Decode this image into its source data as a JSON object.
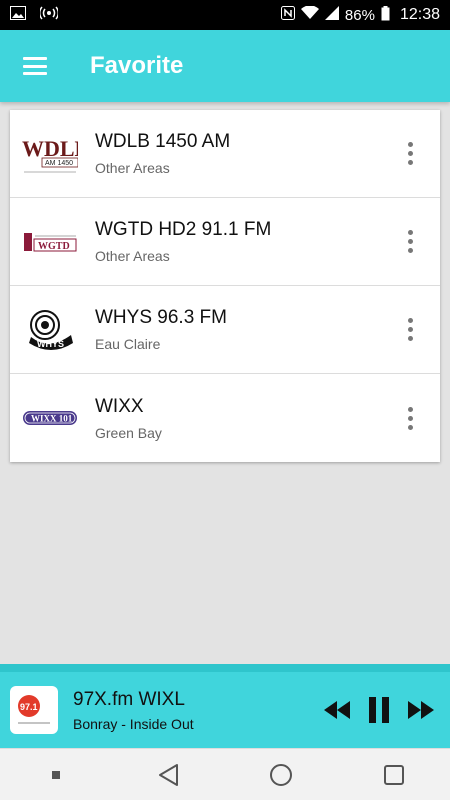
{
  "status_bar": {
    "battery": "86%",
    "time": "12:38",
    "icons": [
      "image-icon",
      "hotspot-icon",
      "nfc-icon",
      "wifi-icon",
      "signal-icon",
      "battery-icon"
    ]
  },
  "app_bar": {
    "title": "Favorite",
    "menu_icon": "hamburger-menu-icon"
  },
  "favorites": [
    {
      "name": "WDLB 1450 AM",
      "area": "Other Areas",
      "logo": "wdlb-logo"
    },
    {
      "name": "WGTD HD2 91.1 FM",
      "area": "Other Areas",
      "logo": "wgtd-logo"
    },
    {
      "name": "WHYS 96.3 FM",
      "area": "Eau Claire",
      "logo": "whys-logo"
    },
    {
      "name": "WIXX",
      "area": "Green Bay",
      "logo": "wixx-logo"
    }
  ],
  "logos": {
    "wdlb_big": "WDLB",
    "wdlb_small": "AM 1450",
    "wgtd": "WGTD",
    "whys": "WHYS",
    "wixx": "WIXX 101",
    "player": "97.1 fm"
  },
  "player": {
    "station": "97X.fm WIXL",
    "track": "Bonray - Inside Out"
  },
  "colors": {
    "accent": "#40d5dc",
    "status_bar": "#000000"
  }
}
